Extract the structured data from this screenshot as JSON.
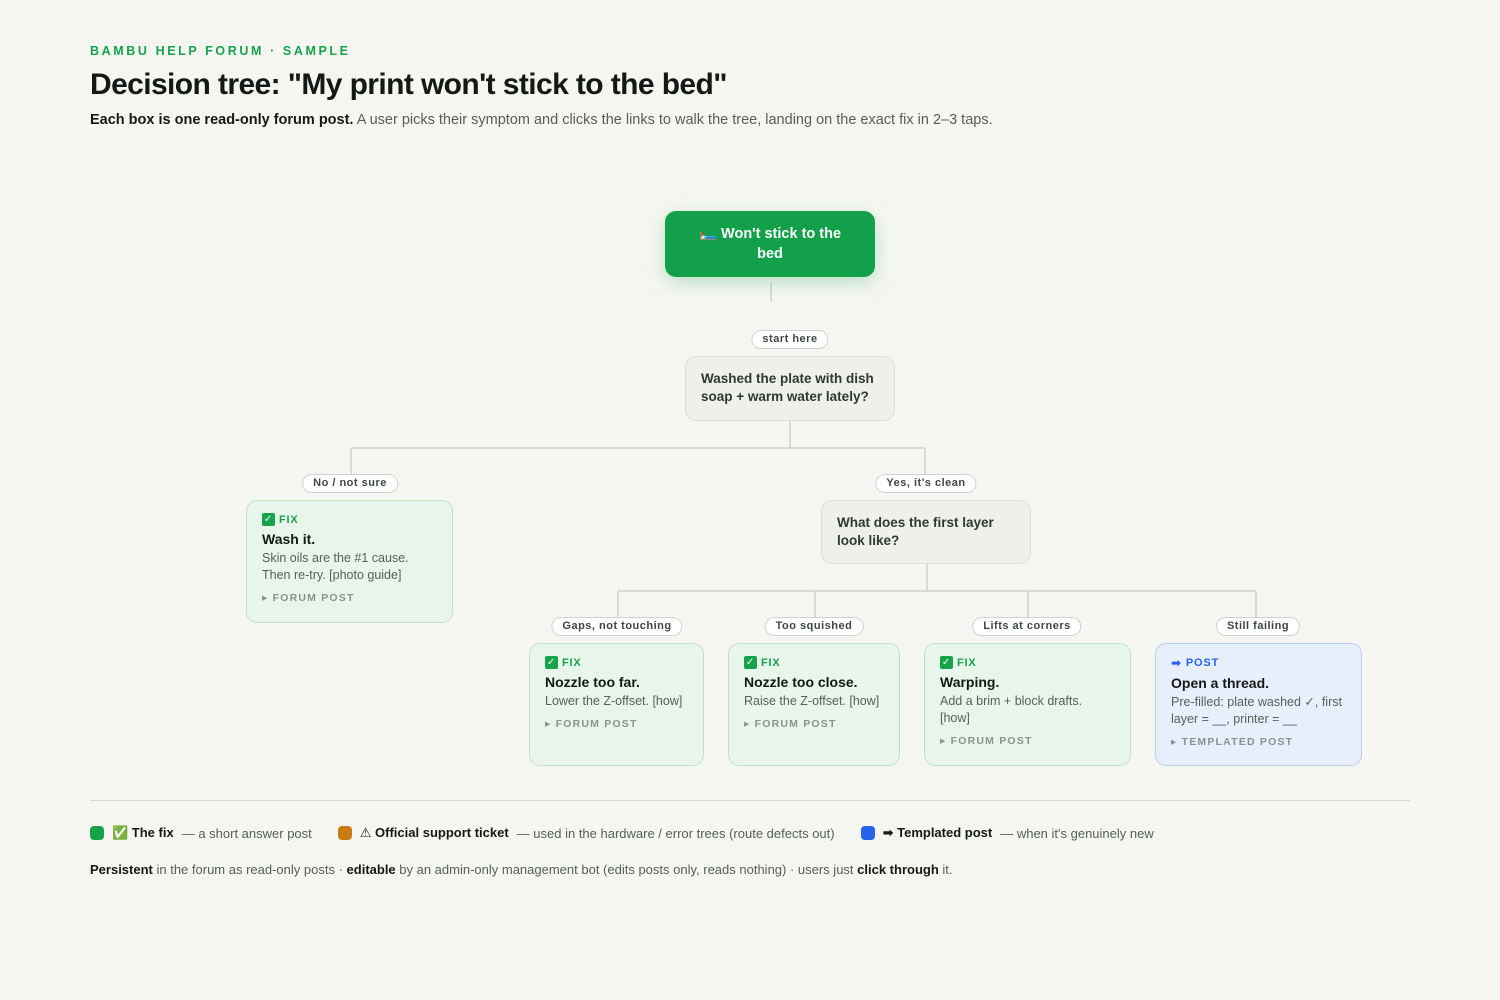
{
  "header": {
    "eyebrow": "BAMBU HELP FORUM · SAMPLE",
    "title": "Decision tree: \"My print won't stick to the bed\"",
    "subtitle_bold": "Each box is one read-only forum post.",
    "subtitle_rest": " A user picks their symptom and clicks the links to walk the tree, landing on the exact fix in 2–3 taps."
  },
  "tree": {
    "root": {
      "icon": "🛏️",
      "label": "Won't stick to the bed"
    },
    "start_label": "start here",
    "q1": {
      "text": "Washed the plate with dish soap + warm water lately?"
    },
    "q1_no": "No / not sure",
    "q1_yes": "Yes, it's clean",
    "fix_wash": {
      "tag": "FIX",
      "title": "Wash it.",
      "desc": "Skin oils are the #1 cause. Then re-try. [photo guide]",
      "footer": "▸ FORUM POST"
    },
    "q2": {
      "text": "What does the first layer look like?"
    },
    "b_gaps": "Gaps, not touching",
    "b_squished": "Too squished",
    "b_lifts": "Lifts at corners",
    "b_still": "Still failing",
    "fix_far": {
      "tag": "FIX",
      "title": "Nozzle too far.",
      "desc": "Lower the Z-offset. [how]",
      "footer": "▸ FORUM POST"
    },
    "fix_close": {
      "tag": "FIX",
      "title": "Nozzle too close.",
      "desc": "Raise the Z-offset. [how]",
      "footer": "▸ FORUM POST"
    },
    "fix_warp": {
      "tag": "FIX",
      "title": "Warping.",
      "desc": "Add a brim + block drafts. [how]",
      "footer": "▸ FORUM POST"
    },
    "post_thread": {
      "tag": "POST",
      "title": "Open a thread.",
      "desc": "Pre-filled: plate washed ✓, first layer = __, printer = __",
      "footer": "▸ TEMPLATED POST"
    }
  },
  "legend": {
    "fix_label": "✅ The fix",
    "fix_desc": "— a short answer post",
    "ticket_label": "⚠ Official support ticket",
    "ticket_desc": "— used in the hardware / error trees (route defects out)",
    "post_label": "➡ Templated post",
    "post_desc": "— when it's genuinely new",
    "colors": {
      "fix": "#16a34a",
      "ticket": "#c97c14",
      "post": "#2563eb"
    }
  },
  "note": {
    "p1": "Persistent",
    "p2": " in the forum as read-only posts · ",
    "p3": "editable",
    "p4": " by an admin-only management bot (edits posts only, reads nothing) · users just ",
    "p5": "click through",
    "p6": " it."
  }
}
